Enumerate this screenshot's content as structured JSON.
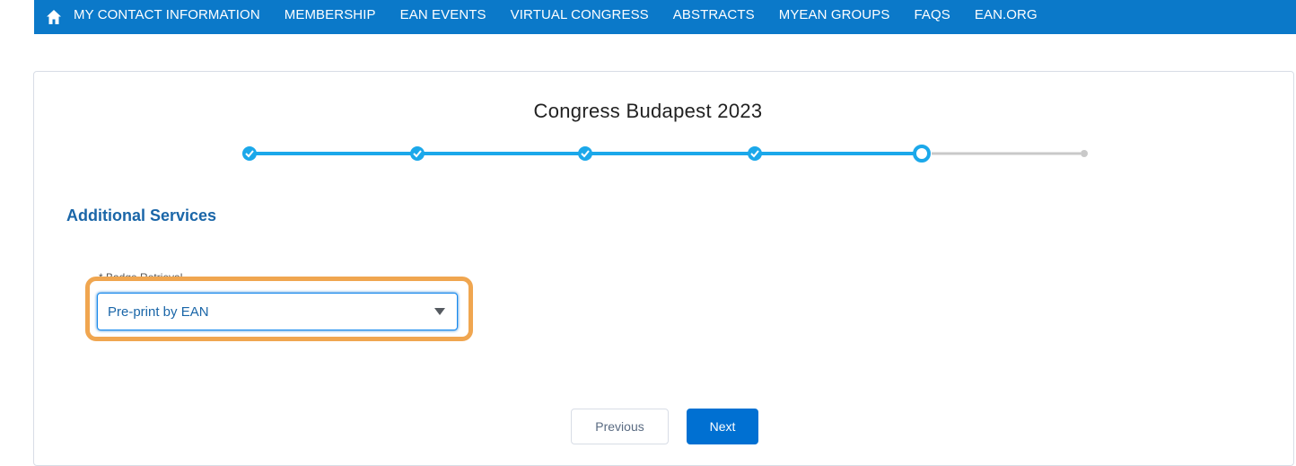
{
  "nav": {
    "home_icon": "home-icon",
    "items": [
      {
        "label": "MY CONTACT INFORMATION"
      },
      {
        "label": "MEMBERSHIP"
      },
      {
        "label": "EAN EVENTS"
      },
      {
        "label": "VIRTUAL CONGRESS"
      },
      {
        "label": "ABSTRACTS"
      },
      {
        "label": "MYEAN GROUPS"
      },
      {
        "label": "FAQS"
      },
      {
        "label": "EAN.ORG"
      }
    ]
  },
  "page": {
    "title": "Congress Budapest 2023",
    "steps": [
      "completed",
      "completed",
      "completed",
      "completed",
      "current",
      "pending"
    ],
    "section_title": "Additional Services",
    "field_label": "* Badge Retrieval",
    "select_value": "Pre-print by EAN",
    "buttons": {
      "previous": "Previous",
      "next": "Next"
    }
  },
  "colors": {
    "nav_bg": "#0b79c9",
    "step_active": "#1ba8ea",
    "step_pending": "#c9c9c9",
    "highlight": "#f0a650",
    "primary": "#0070d2"
  }
}
